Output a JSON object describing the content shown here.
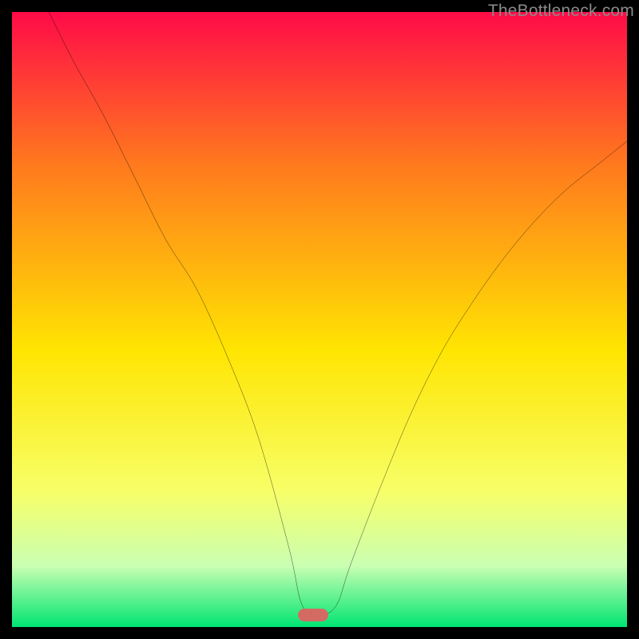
{
  "watermark": "TheBottleneck.com",
  "marker": {
    "x_percent": 49,
    "y_percent": 98
  },
  "colors": {
    "top": "#ff0b48",
    "upper_mid": "#ff7a1d",
    "mid": "#ffe502",
    "lower_mid": "#f7ff68",
    "lower": "#caffb2",
    "bottom": "#00e572",
    "marker": "#d46b63",
    "curve": "#000000",
    "frame": "#000000",
    "watermark": "#8a8a8a"
  },
  "chart_data": {
    "type": "line",
    "title": "",
    "xlabel": "",
    "ylabel": "",
    "xlim": [
      0,
      100
    ],
    "ylim": [
      0,
      100
    ],
    "note": "Single V-shaped bottleneck curve over vertical gradient. No axis tick labels are visible; x/y units are percent of plot area. y=100 is top, y=0 is bottom. Values estimated from pixels.",
    "series": [
      {
        "name": "bottleneck-curve",
        "x": [
          6,
          10,
          15,
          20,
          25,
          30,
          35,
          40,
          45,
          47,
          49,
          51,
          53,
          55,
          60,
          65,
          70,
          75,
          80,
          85,
          90,
          95,
          100
        ],
        "y": [
          100,
          92,
          83,
          73,
          63,
          55,
          44,
          31,
          13,
          4,
          2,
          2,
          4,
          10,
          23,
          35,
          45,
          53,
          60,
          66,
          71,
          75,
          79
        ]
      }
    ],
    "marker_point": {
      "x": 49,
      "y": 2
    },
    "gradient_stops": [
      {
        "pct": 0,
        "color": "#ff0b48"
      },
      {
        "pct": 25,
        "color": "#ff7a1d"
      },
      {
        "pct": 55,
        "color": "#ffe502"
      },
      {
        "pct": 78,
        "color": "#f7ff68"
      },
      {
        "pct": 90,
        "color": "#caffb2"
      },
      {
        "pct": 100,
        "color": "#00e572"
      }
    ]
  }
}
